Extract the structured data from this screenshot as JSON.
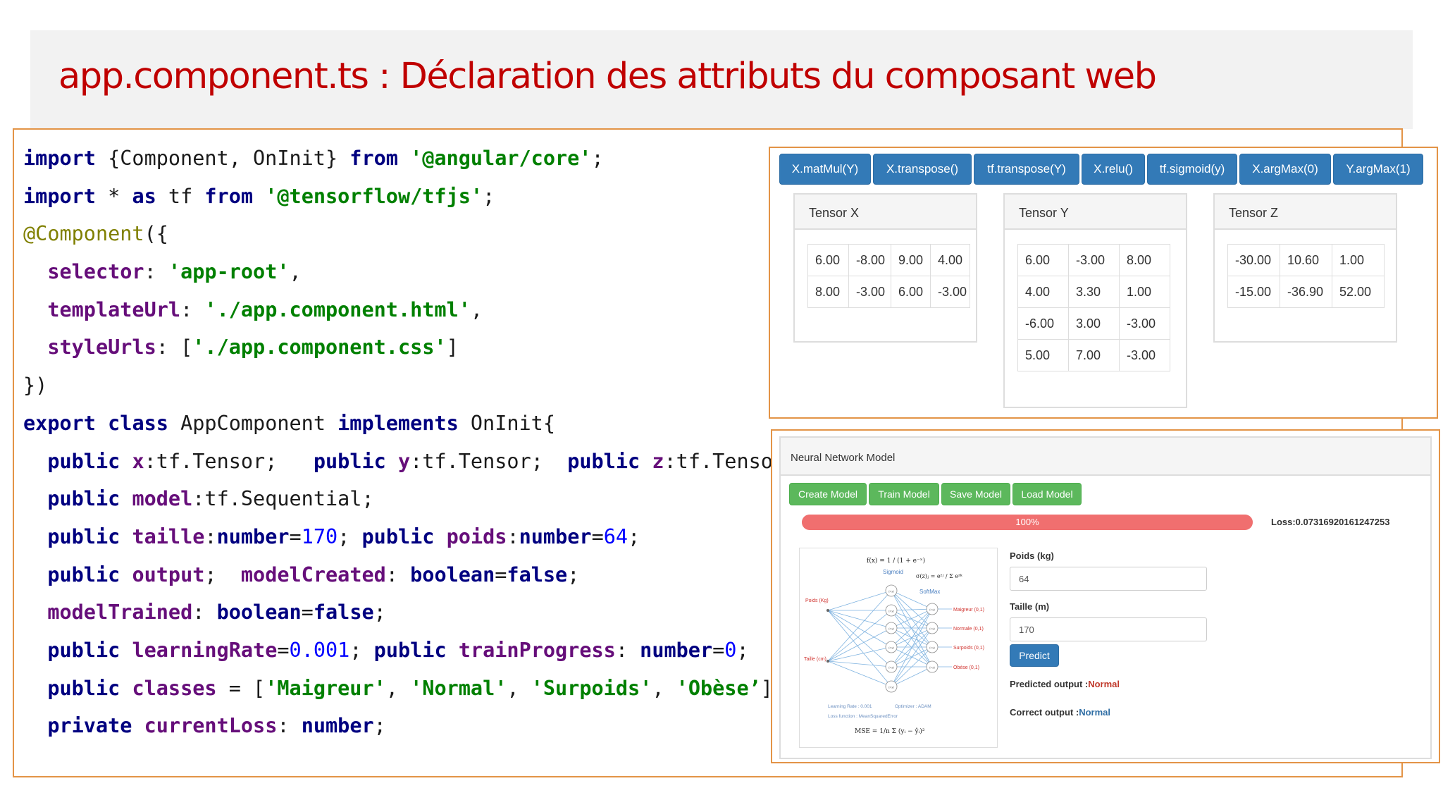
{
  "slide": {
    "title": "app.component.ts : Déclaration des attributs du composant web"
  },
  "code": {
    "lines": [
      [
        {
          "t": "import",
          "c": "kw"
        },
        {
          "t": " {Component, OnInit} "
        },
        {
          "t": "from",
          "c": "kw"
        },
        {
          "t": " "
        },
        {
          "t": "'@angular/core'",
          "c": "str"
        },
        {
          "t": ";"
        }
      ],
      [
        {
          "t": "import",
          "c": "kw"
        },
        {
          "t": " * "
        },
        {
          "t": "as",
          "c": "kw"
        },
        {
          "t": " tf "
        },
        {
          "t": "from",
          "c": "kw"
        },
        {
          "t": " "
        },
        {
          "t": "'@tensorflow/tfjs'",
          "c": "str"
        },
        {
          "t": ";"
        }
      ],
      [
        {
          "t": "@Component",
          "c": "ann"
        },
        {
          "t": "({"
        }
      ],
      [
        {
          "t": "  "
        },
        {
          "t": "selector",
          "c": "attr"
        },
        {
          "t": ": "
        },
        {
          "t": "'app-root'",
          "c": "str"
        },
        {
          "t": ","
        }
      ],
      [
        {
          "t": "  "
        },
        {
          "t": "templateUrl",
          "c": "attr"
        },
        {
          "t": ": "
        },
        {
          "t": "'./app.component.html'",
          "c": "str"
        },
        {
          "t": ","
        }
      ],
      [
        {
          "t": "  "
        },
        {
          "t": "styleUrls",
          "c": "attr"
        },
        {
          "t": ": ["
        },
        {
          "t": "'./app.component.css'",
          "c": "str"
        },
        {
          "t": "]"
        }
      ],
      [
        {
          "t": "})"
        }
      ],
      [
        {
          "t": "export",
          "c": "kw"
        },
        {
          "t": " "
        },
        {
          "t": "class",
          "c": "kw"
        },
        {
          "t": " AppComponent "
        },
        {
          "t": "implements",
          "c": "kw"
        },
        {
          "t": " OnInit{"
        }
      ],
      [
        {
          "t": "  "
        },
        {
          "t": "public",
          "c": "kw"
        },
        {
          "t": " "
        },
        {
          "t": "x",
          "c": "attr"
        },
        {
          "t": ":tf.Tensor;   "
        },
        {
          "t": "public",
          "c": "kw"
        },
        {
          "t": " "
        },
        {
          "t": "y",
          "c": "attr"
        },
        {
          "t": ":tf.Tensor;  "
        },
        {
          "t": "public",
          "c": "kw"
        },
        {
          "t": " "
        },
        {
          "t": "z",
          "c": "attr"
        },
        {
          "t": ":tf.Tensor;"
        }
      ],
      [
        {
          "t": "  "
        },
        {
          "t": "public",
          "c": "kw"
        },
        {
          "t": " "
        },
        {
          "t": "model",
          "c": "attr"
        },
        {
          "t": ":tf.Sequential;"
        }
      ],
      [
        {
          "t": "  "
        },
        {
          "t": "public",
          "c": "kw"
        },
        {
          "t": " "
        },
        {
          "t": "taille",
          "c": "attr"
        },
        {
          "t": ":"
        },
        {
          "t": "number",
          "c": "kw"
        },
        {
          "t": "="
        },
        {
          "t": "170",
          "c": "num"
        },
        {
          "t": "; "
        },
        {
          "t": "public",
          "c": "kw"
        },
        {
          "t": " "
        },
        {
          "t": "poids",
          "c": "attr"
        },
        {
          "t": ":"
        },
        {
          "t": "number",
          "c": "kw"
        },
        {
          "t": "="
        },
        {
          "t": "64",
          "c": "num"
        },
        {
          "t": ";"
        }
      ],
      [
        {
          "t": "  "
        },
        {
          "t": "public",
          "c": "kw"
        },
        {
          "t": " "
        },
        {
          "t": "output",
          "c": "attr"
        },
        {
          "t": ";  "
        },
        {
          "t": "modelCreated",
          "c": "attr"
        },
        {
          "t": ": "
        },
        {
          "t": "boolean",
          "c": "kw"
        },
        {
          "t": "="
        },
        {
          "t": "false",
          "c": "kw"
        },
        {
          "t": ";"
        }
      ],
      [
        {
          "t": "  "
        },
        {
          "t": "modelTrained",
          "c": "attr"
        },
        {
          "t": ": "
        },
        {
          "t": "boolean",
          "c": "kw"
        },
        {
          "t": "="
        },
        {
          "t": "false",
          "c": "kw"
        },
        {
          "t": ";"
        }
      ],
      [
        {
          "t": "  "
        },
        {
          "t": "public",
          "c": "kw"
        },
        {
          "t": " "
        },
        {
          "t": "learningRate",
          "c": "attr"
        },
        {
          "t": "="
        },
        {
          "t": "0.001",
          "c": "num"
        },
        {
          "t": "; "
        },
        {
          "t": "public",
          "c": "kw"
        },
        {
          "t": " "
        },
        {
          "t": "trainProgress",
          "c": "attr"
        },
        {
          "t": ": "
        },
        {
          "t": "number",
          "c": "kw"
        },
        {
          "t": "="
        },
        {
          "t": "0",
          "c": "num"
        },
        {
          "t": ";"
        }
      ],
      [
        {
          "t": "  "
        },
        {
          "t": "public",
          "c": "kw"
        },
        {
          "t": " "
        },
        {
          "t": "classes",
          "c": "attr"
        },
        {
          "t": " = ["
        },
        {
          "t": "'Maigreur'",
          "c": "str"
        },
        {
          "t": ", "
        },
        {
          "t": "'Normal'",
          "c": "str"
        },
        {
          "t": ", "
        },
        {
          "t": "'Surpoids'",
          "c": "str"
        },
        {
          "t": ", "
        },
        {
          "t": "'Obèse’",
          "c": "str"
        },
        {
          "t": "];"
        }
      ],
      [
        {
          "t": "  "
        },
        {
          "t": "private",
          "c": "kw"
        },
        {
          "t": " "
        },
        {
          "t": "currentLoss",
          "c": "attr"
        },
        {
          "t": ": "
        },
        {
          "t": "number",
          "c": "kw"
        },
        {
          "t": ";"
        }
      ]
    ]
  },
  "tensor_panel": {
    "buttons": [
      "X.matMul(Y)",
      "X.transpose()",
      "tf.transpose(Y)",
      "X.relu()",
      "tf.sigmoid(y)",
      "X.argMax(0)",
      "Y.argMax(1)"
    ],
    "tensor_x": {
      "title": "Tensor X",
      "rows": [
        [
          "6.00",
          "-8.00",
          "9.00",
          "4.00"
        ],
        [
          "8.00",
          "-3.00",
          "6.00",
          "-3.00"
        ]
      ]
    },
    "tensor_y": {
      "title": "Tensor Y",
      "rows": [
        [
          "6.00",
          "-3.00",
          "8.00"
        ],
        [
          "4.00",
          "3.30",
          "1.00"
        ],
        [
          "-6.00",
          "3.00",
          "-3.00"
        ],
        [
          "5.00",
          "7.00",
          "-3.00"
        ]
      ]
    },
    "tensor_z": {
      "title": "Tensor Z",
      "rows": [
        [
          "-30.00",
          "10.60",
          "1.00"
        ],
        [
          "-15.00",
          "-36.90",
          "52.00"
        ]
      ]
    }
  },
  "nn_panel": {
    "title": "Neural Network Model",
    "buttons": {
      "create": "Create Model",
      "train": "Train Model",
      "save": "Save Model",
      "load": "Load Model"
    },
    "progress": {
      "value": 100,
      "label": "100%"
    },
    "loss_text": "Loss:0.07316920161247253",
    "diagram": {
      "sigmoid_label": "Sigmoid",
      "softmax_label": "SoftMax",
      "input_poids": "Poids (Kg)",
      "input_taille": "Taille (cm)",
      "out_maigreur": "Maigreur (0,1)",
      "out_normale": "Normale (0,1)",
      "out_surpoids": "Surpoids (0,1)",
      "out_obese": "Obèse (0,1)",
      "learning_rate": "Learning Rate : 0.001",
      "optimizer": "Optimizer : ADAM",
      "loss_fn": "Loss function : MeanSquaredError",
      "formula_f": "f(x) = 1 / (1 + e⁻ˣ)",
      "formula_sigma": "σ(z)ⱼ = eᶻʲ / Σ eᶻᵏ",
      "formula_mse": "MSE = 1/n Σ (yᵢ − ŷᵢ)²",
      "node_symbol": "(x,y)"
    },
    "poids_label": "Poids (kg)",
    "poids_value": "64",
    "taille_label": "Taille (m)",
    "taille_value": "170",
    "predict_label": "Predict",
    "predicted_label": "Predicted output :",
    "predicted_value": "Normal",
    "correct_label": "Correct output :",
    "correct_value": "Normal"
  }
}
